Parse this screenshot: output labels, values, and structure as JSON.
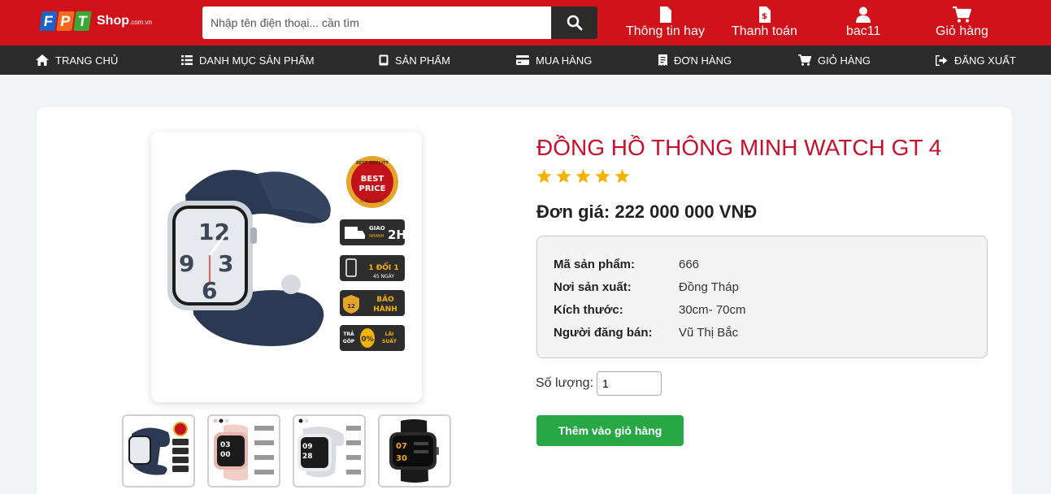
{
  "header": {
    "logo": {
      "letters": [
        "F",
        "P",
        "T"
      ],
      "brand": "Shop",
      "suffix": ".com.vn"
    },
    "search": {
      "placeholder": "Nhập tên điện thoại... cần tìm",
      "icon": "search-icon"
    },
    "items": [
      {
        "label": "Thông tin hay",
        "icon": "document-icon"
      },
      {
        "label": "Thanh toán",
        "icon": "invoice-dollar-icon"
      },
      {
        "label": "bac11",
        "icon": "user-icon"
      },
      {
        "label": "Giỏ hàng",
        "icon": "cart-icon"
      }
    ],
    "colors": {
      "brand": "#d0121a",
      "nav": "#2b2b2b",
      "logo_f": "#1e63c7",
      "logo_p": "#f26a21",
      "logo_t": "#3aa935"
    }
  },
  "nav": {
    "items": [
      {
        "label": "TRANG CHỦ",
        "icon": "home-icon"
      },
      {
        "label": "DANH MỤC SẢN PHẨM",
        "icon": "list-icon"
      },
      {
        "label": "SẢN PHẨM",
        "icon": "tablet-icon"
      },
      {
        "label": "MUA HÀNG",
        "icon": "credit-card-icon"
      },
      {
        "label": "ĐƠN HÀNG",
        "icon": "receipt-icon"
      },
      {
        "label": "GIỎ HÀNG",
        "icon": "cart-icon"
      },
      {
        "label": "ĐĂNG XUẤT",
        "icon": "sign-out-icon"
      }
    ]
  },
  "product": {
    "title": "ĐỒNG HỒ THÔNG MINH WATCH GT 4",
    "rating": 5,
    "price_label": "Đơn giá:",
    "price_value": "222 000 000 VNĐ",
    "specs": [
      {
        "label": "Mã sản phẩm:",
        "value": "666"
      },
      {
        "label": "Nơi sản xuất:",
        "value": "Đồng Tháp"
      },
      {
        "label": "Kích thước:",
        "value": "30cm- 70cm"
      },
      {
        "label": "Người đăng bán:",
        "value": "Vũ Thị Bắc"
      }
    ],
    "quantity_label": "Số lượng:",
    "quantity_value": "1",
    "add_to_cart": "Thêm vào giỏ hàng",
    "badges": {
      "best_price_top": "BEST QUALITY",
      "best_price_1": "BEST",
      "best_price_2": "PRICE",
      "best_price_bottom": "CHÍNH HÃNG",
      "delivery_1": "GIAO",
      "delivery_2": "NHANH",
      "delivery_3": "2H",
      "exchange_1": "1 ĐỔI 1",
      "exchange_2": "45 NGÀY",
      "warranty_num": "12",
      "warranty_1": "BẢO",
      "warranty_2": "HÀNH",
      "installment_1": "TRẢ",
      "installment_2": "GÓP",
      "installment_pct": "0%",
      "installment_3": "LÃI",
      "installment_4": "SUẤT"
    },
    "thumbnails": [
      "watch-navy",
      "watch-pink",
      "watch-white",
      "watch-black"
    ],
    "colors": {
      "title": "#c8102e",
      "star": "#f5b301",
      "button": "#28a745"
    }
  }
}
